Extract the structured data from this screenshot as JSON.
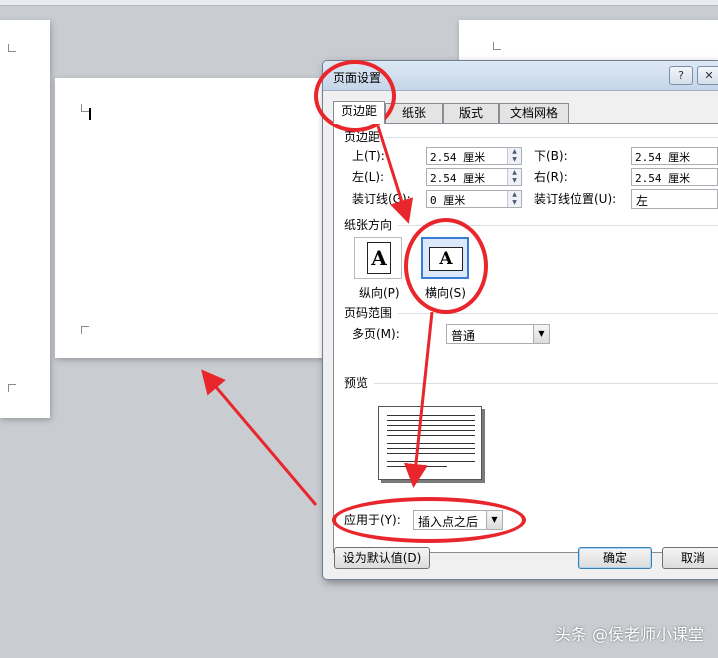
{
  "dialog": {
    "title": "页面设置",
    "help_glyph": "?",
    "close_glyph": "✕",
    "tabs": [
      {
        "label": "页边距"
      },
      {
        "label": "纸张"
      },
      {
        "label": "版式"
      },
      {
        "label": "文档网格"
      }
    ],
    "margins": {
      "group_label": "页边距",
      "top": {
        "label": "上(T):",
        "value": "2.54 厘米"
      },
      "bottom": {
        "label": "下(B):",
        "value": "2.54 厘米"
      },
      "left": {
        "label": "左(L):",
        "value": "2.54 厘米"
      },
      "right": {
        "label": "右(R):",
        "value": "2.54 厘米"
      },
      "gutter": {
        "label": "装订线(G):",
        "value": "0 厘米"
      },
      "gutter_pos": {
        "label": "装订线位置(U):",
        "value": "左"
      }
    },
    "orientation": {
      "group_label": "纸张方向",
      "portrait": {
        "label": "纵向(P)",
        "glyph": "A"
      },
      "landscape": {
        "label": "横向(S)",
        "glyph": "A"
      }
    },
    "pages": {
      "group_label": "页码范围",
      "multi_label": "多页(M):",
      "multi_value": "普通"
    },
    "preview": {
      "group_label": "预览"
    },
    "apply_to": {
      "label": "应用于(Y):",
      "value": "插入点之后"
    },
    "buttons": {
      "set_default": "设为默认值(D)",
      "ok": "确定",
      "cancel": "取消"
    },
    "dropdown_glyph": "▼",
    "spin_up": "▲",
    "spin_down": "▼"
  },
  "watermark": "头条 @侯老师小课堂",
  "colors": {
    "highlight_ring": "#e8262b",
    "selected_option": "#3a7bd5",
    "canvas": "#c9ccd1"
  }
}
